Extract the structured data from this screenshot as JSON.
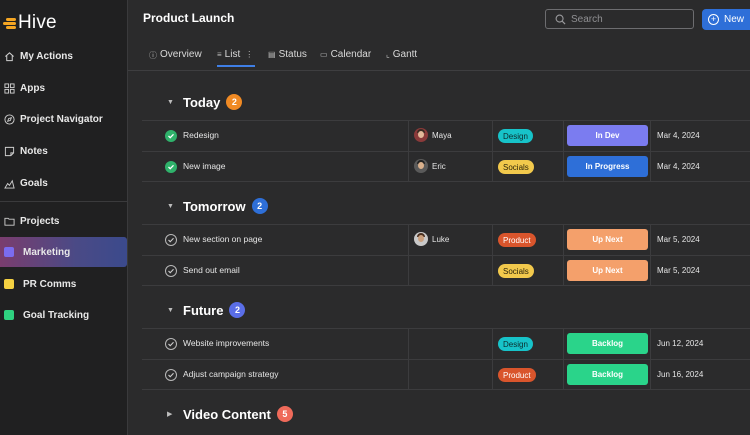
{
  "app": {
    "name": "Hive"
  },
  "sidebar": {
    "items": [
      {
        "label": "My Actions",
        "icon": "home-icon"
      },
      {
        "label": "Apps",
        "icon": "apps-grid-icon"
      },
      {
        "label": "Project Navigator",
        "icon": "compass-icon"
      },
      {
        "label": "Notes",
        "icon": "note-icon"
      },
      {
        "label": "Goals",
        "icon": "goals-icon"
      },
      {
        "label": "Projects",
        "icon": "folder-icon"
      }
    ],
    "projects": [
      {
        "label": "Marketing",
        "color": "#7b6cf0",
        "active": true
      },
      {
        "label": "PR Comms",
        "color": "#f5d142",
        "active": false
      },
      {
        "label": "Goal Tracking",
        "color": "#2fd180",
        "active": false
      }
    ]
  },
  "header": {
    "title": "Product Launch",
    "search_placeholder": "Search",
    "new_label": "New"
  },
  "tabs": [
    {
      "label": "Overview",
      "icon": "info-icon"
    },
    {
      "label": "List",
      "icon": "list-icon",
      "active": true
    },
    {
      "label": "Status",
      "icon": "status-icon"
    },
    {
      "label": "Calendar",
      "icon": "calendar-icon"
    },
    {
      "label": "Gantt",
      "icon": "gantt-icon"
    }
  ],
  "sections": [
    {
      "title": "Today",
      "count": "2",
      "count_color": "#f08a24",
      "expanded": true,
      "tasks": [
        {
          "name": "Redesign",
          "done": true,
          "assignee": "Maya",
          "tag": "Design",
          "tag_color": "#17c3c9",
          "tag_text": "#0d2b2c",
          "status": "In Dev",
          "status_color": "#7b7cf0",
          "date": "Mar 4, 2024"
        },
        {
          "name": "New image",
          "done": true,
          "assignee": "Eric",
          "tag": "Socials",
          "tag_color": "#f2c94c",
          "tag_text": "#2b230a",
          "status": "In Progress",
          "status_color": "#2e6fd8",
          "date": "Mar 4, 2024"
        }
      ]
    },
    {
      "title": "Tomorrow",
      "count": "2",
      "count_color": "#2e6fd8",
      "expanded": true,
      "tasks": [
        {
          "name": "New section on page",
          "done": false,
          "assignee": "Luke",
          "tag": "Product",
          "tag_color": "#d9552c",
          "tag_text": "#ffffff",
          "status": "Up Next",
          "status_color": "#f4a06b",
          "date": "Mar 5, 2024"
        },
        {
          "name": "Send out email",
          "done": false,
          "assignee": "",
          "tag": "Socials",
          "tag_color": "#f2c94c",
          "tag_text": "#2b230a",
          "status": "Up Next",
          "status_color": "#f4a06b",
          "date": "Mar 5, 2024"
        }
      ]
    },
    {
      "title": "Future",
      "count": "2",
      "count_color": "#5a6ee8",
      "expanded": true,
      "tasks": [
        {
          "name": "Website improvements",
          "done": false,
          "assignee": "",
          "tag": "Design",
          "tag_color": "#17c3c9",
          "tag_text": "#0d2b2c",
          "status": "Backlog",
          "status_color": "#2ad48a",
          "date": "Jun 12, 2024"
        },
        {
          "name": "Adjust campaign strategy",
          "done": false,
          "assignee": "",
          "tag": "Product",
          "tag_color": "#d9552c",
          "tag_text": "#ffffff",
          "status": "Backlog",
          "status_color": "#2ad48a",
          "date": "Jun 16, 2024"
        }
      ]
    },
    {
      "title": "Video Content",
      "count": "5",
      "count_color": "#ef6a5a",
      "expanded": false,
      "tasks": []
    }
  ]
}
